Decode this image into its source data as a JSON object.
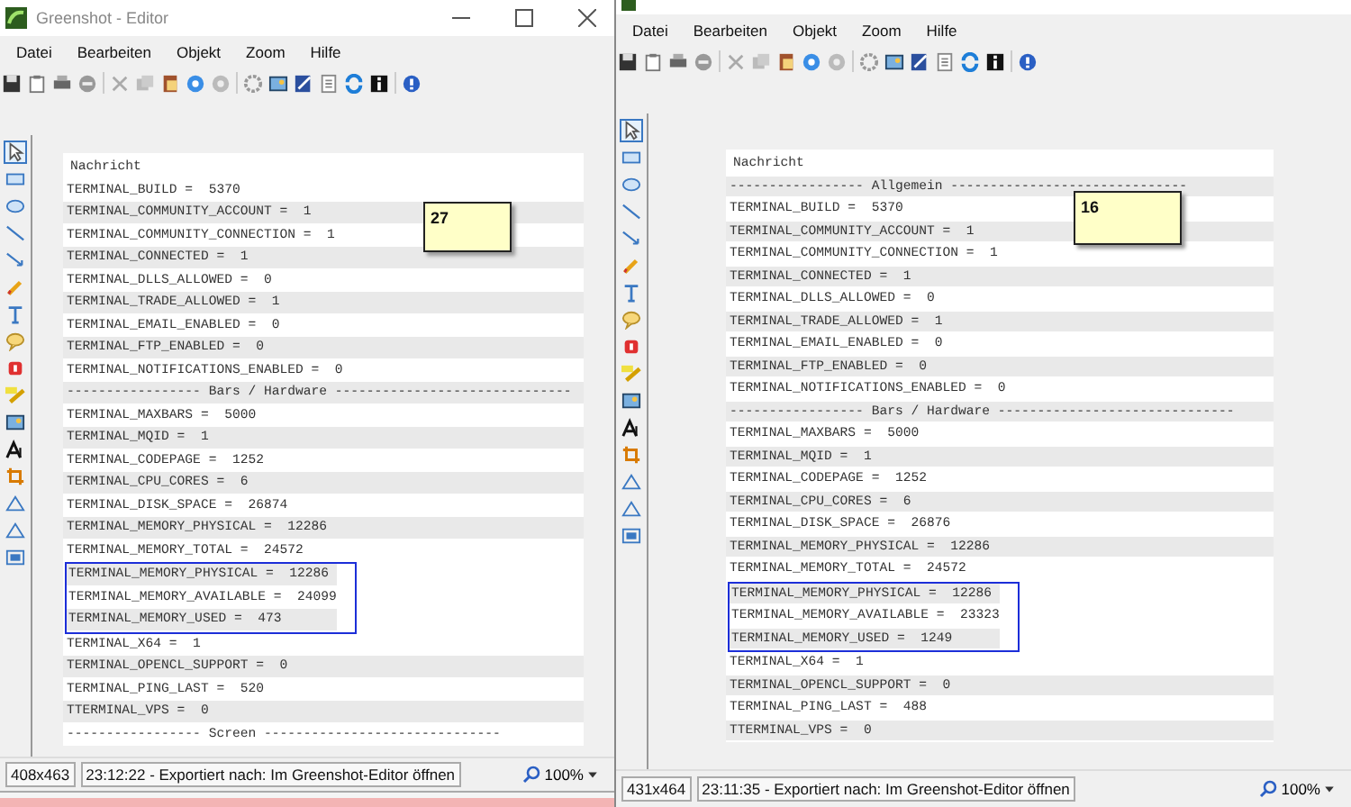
{
  "windows": [
    {
      "title": "Greenshot - Editor",
      "menu": [
        "Datei",
        "Bearbeiten",
        "Objekt",
        "Zoom",
        "Hilfe"
      ],
      "rows": [
        {
          "kind": "header",
          "text": "Nachricht",
          "shaded": false,
          "boxed": false
        },
        {
          "kind": "entry",
          "text": "TERMINAL_BUILD =  5370",
          "shaded": false,
          "boxed": false
        },
        {
          "kind": "entry",
          "text": "TERMINAL_COMMUNITY_ACCOUNT =  1",
          "shaded": true,
          "boxed": false
        },
        {
          "kind": "entry",
          "text": "TERMINAL_COMMUNITY_CONNECTION =  1",
          "shaded": false,
          "boxed": false
        },
        {
          "kind": "entry",
          "text": "TERMINAL_CONNECTED =  1",
          "shaded": true,
          "boxed": false
        },
        {
          "kind": "entry",
          "text": "TERMINAL_DLLS_ALLOWED =  0",
          "shaded": false,
          "boxed": false
        },
        {
          "kind": "entry",
          "text": "TERMINAL_TRADE_ALLOWED =  1",
          "shaded": true,
          "boxed": false
        },
        {
          "kind": "entry",
          "text": "TERMINAL_EMAIL_ENABLED =  0",
          "shaded": false,
          "boxed": false
        },
        {
          "kind": "entry",
          "text": "TERMINAL_FTP_ENABLED =  0",
          "shaded": true,
          "boxed": false
        },
        {
          "kind": "entry",
          "text": "TERMINAL_NOTIFICATIONS_ENABLED =  0",
          "shaded": false,
          "boxed": false
        },
        {
          "kind": "divider",
          "text": "----------------- Bars / Hardware ------------------------------",
          "shaded": true,
          "boxed": false
        },
        {
          "kind": "entry",
          "text": "TERMINAL_MAXBARS =  5000",
          "shaded": false,
          "boxed": false
        },
        {
          "kind": "entry",
          "text": "TERMINAL_MQID =  1",
          "shaded": true,
          "boxed": false
        },
        {
          "kind": "entry",
          "text": "TERMINAL_CODEPAGE =  1252",
          "shaded": false,
          "boxed": false
        },
        {
          "kind": "entry",
          "text": "TERMINAL_CPU_CORES =  6",
          "shaded": true,
          "boxed": false
        },
        {
          "kind": "entry",
          "text": "TERMINAL_DISK_SPACE =  26874",
          "shaded": false,
          "boxed": false
        },
        {
          "kind": "entry",
          "text": "TERMINAL_MEMORY_PHYSICAL =  12286",
          "shaded": true,
          "boxed": false
        },
        {
          "kind": "entry",
          "text": "TERMINAL_MEMORY_TOTAL =  24572",
          "shaded": false,
          "boxed": false
        },
        {
          "kind": "entry",
          "text": "TERMINAL_MEMORY_PHYSICAL =  12286",
          "shaded": true,
          "boxed": true
        },
        {
          "kind": "entry",
          "text": "TERMINAL_MEMORY_AVAILABLE =  24099",
          "shaded": false,
          "boxed": true
        },
        {
          "kind": "entry",
          "text": "TERMINAL_MEMORY_USED =  473",
          "shaded": true,
          "boxed": true
        },
        {
          "kind": "entry",
          "text": "TERMINAL_X64 =  1",
          "shaded": false,
          "boxed": false
        },
        {
          "kind": "entry",
          "text": "TERMINAL_OPENCL_SUPPORT =  0",
          "shaded": true,
          "boxed": false
        },
        {
          "kind": "entry",
          "text": "TERMINAL_PING_LAST =  520",
          "shaded": false,
          "boxed": false
        },
        {
          "kind": "entry",
          "text": "TTERMINAL_VPS =  0",
          "shaded": true,
          "boxed": false
        },
        {
          "kind": "divider",
          "text": "----------------- Screen ------------------------------",
          "shaded": false,
          "boxed": false
        }
      ],
      "note": "27",
      "status": {
        "size": "408x463",
        "message": "23:12:22 - Exportiert nach: Im Greenshot-Editor öffnen",
        "zoom": "100%"
      }
    },
    {
      "menu": [
        "Datei",
        "Bearbeiten",
        "Objekt",
        "Zoom",
        "Hilfe"
      ],
      "rows": [
        {
          "kind": "header",
          "text": "Nachricht",
          "shaded": false,
          "boxed": false
        },
        {
          "kind": "divider",
          "text": "----------------- Allgemein ------------------------------",
          "shaded": true,
          "boxed": false
        },
        {
          "kind": "entry",
          "text": "TERMINAL_BUILD =  5370",
          "shaded": false,
          "boxed": false
        },
        {
          "kind": "entry",
          "text": "TERMINAL_COMMUNITY_ACCOUNT =  1",
          "shaded": true,
          "boxed": false
        },
        {
          "kind": "entry",
          "text": "TERMINAL_COMMUNITY_CONNECTION =  1",
          "shaded": false,
          "boxed": false
        },
        {
          "kind": "entry",
          "text": "TERMINAL_CONNECTED =  1",
          "shaded": true,
          "boxed": false
        },
        {
          "kind": "entry",
          "text": "TERMINAL_DLLS_ALLOWED =  0",
          "shaded": false,
          "boxed": false
        },
        {
          "kind": "entry",
          "text": "TERMINAL_TRADE_ALLOWED =  1",
          "shaded": true,
          "boxed": false
        },
        {
          "kind": "entry",
          "text": "TERMINAL_EMAIL_ENABLED =  0",
          "shaded": false,
          "boxed": false
        },
        {
          "kind": "entry",
          "text": "TERMINAL_FTP_ENABLED =  0",
          "shaded": true,
          "boxed": false
        },
        {
          "kind": "entry",
          "text": "TERMINAL_NOTIFICATIONS_ENABLED =  0",
          "shaded": false,
          "boxed": false
        },
        {
          "kind": "divider",
          "text": "----------------- Bars / Hardware ------------------------------",
          "shaded": true,
          "boxed": false
        },
        {
          "kind": "entry",
          "text": "TERMINAL_MAXBARS =  5000",
          "shaded": false,
          "boxed": false
        },
        {
          "kind": "entry",
          "text": "TERMINAL_MQID =  1",
          "shaded": true,
          "boxed": false
        },
        {
          "kind": "entry",
          "text": "TERMINAL_CODEPAGE =  1252",
          "shaded": false,
          "boxed": false
        },
        {
          "kind": "entry",
          "text": "TERMINAL_CPU_CORES =  6",
          "shaded": true,
          "boxed": false
        },
        {
          "kind": "entry",
          "text": "TERMINAL_DISK_SPACE =  26876",
          "shaded": false,
          "boxed": false
        },
        {
          "kind": "entry",
          "text": "TERMINAL_MEMORY_PHYSICAL =  12286",
          "shaded": true,
          "boxed": false
        },
        {
          "kind": "entry",
          "text": "TERMINAL_MEMORY_TOTAL =  24572",
          "shaded": false,
          "boxed": false
        },
        {
          "kind": "entry",
          "text": "TERMINAL_MEMORY_PHYSICAL =  12286",
          "shaded": true,
          "boxed": true
        },
        {
          "kind": "entry",
          "text": "TERMINAL_MEMORY_AVAILABLE =  23323",
          "shaded": false,
          "boxed": true
        },
        {
          "kind": "entry",
          "text": "TERMINAL_MEMORY_USED =  1249",
          "shaded": true,
          "boxed": true
        },
        {
          "kind": "entry",
          "text": "TERMINAL_X64 =  1",
          "shaded": false,
          "boxed": false
        },
        {
          "kind": "entry",
          "text": "TERMINAL_OPENCL_SUPPORT =  0",
          "shaded": true,
          "boxed": false
        },
        {
          "kind": "entry",
          "text": "TERMINAL_PING_LAST =  488",
          "shaded": false,
          "boxed": false
        },
        {
          "kind": "entry",
          "text": "TTERMINAL_VPS =  0",
          "shaded": true,
          "boxed": false
        }
      ],
      "note": "16",
      "status": {
        "size": "431x464",
        "message": "23:11:35 - Exportiert nach: Im Greenshot-Editor öffnen",
        "zoom": "100%"
      }
    }
  ]
}
